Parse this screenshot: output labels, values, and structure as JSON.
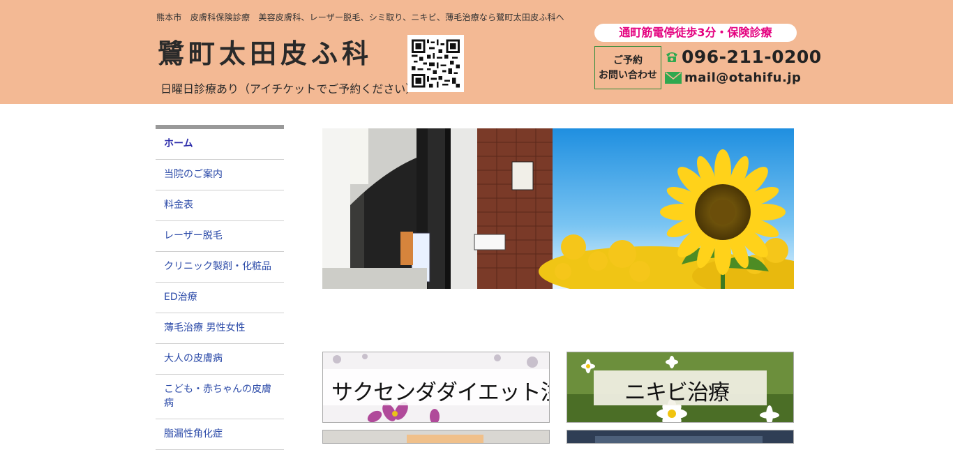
{
  "header": {
    "tagline": "熊本市　皮膚科保険診療　美容皮膚科、レーザー脱毛、シミ取り、ニキビ、薄毛治療なら鷺町太田皮ふ科へ",
    "logo": "鷺町太田皮ふ科",
    "sunday_notice": "日曜日診療あり（アイチケットでご予約ください）",
    "access": "通町筋電停徒歩3分・保険診療",
    "contact_line1": "ご予約",
    "contact_line2": "お問い合わせ",
    "phone": "096-211-0200",
    "email": "mail@otahifu.jp",
    "icons": [
      "qr-code-icon",
      "phone-icon",
      "mail-icon"
    ],
    "colors": {
      "header_bg": "#f3b994",
      "access_text": "#e4007f",
      "contact_border": "#2e8b3a",
      "icon_green": "#2fa84f"
    }
  },
  "sidebar": {
    "items": [
      {
        "label": "ホーム"
      },
      {
        "label": "当院のご案内"
      },
      {
        "label": "料金表"
      },
      {
        "label": "レーザー脱毛"
      },
      {
        "label": "クリニック製剤・化粧品"
      },
      {
        "label": "ED治療"
      },
      {
        "label": "薄毛治療 男性女性"
      },
      {
        "label": "大人の皮膚病"
      },
      {
        "label": "こども・赤ちゃんの皮膚病"
      },
      {
        "label": "脂漏性角化症"
      }
    ],
    "link_color": "#2b4aa8"
  },
  "banners": [
    {
      "label": "サクセンダダイエット注射"
    },
    {
      "label": "ニキビ治療"
    }
  ]
}
